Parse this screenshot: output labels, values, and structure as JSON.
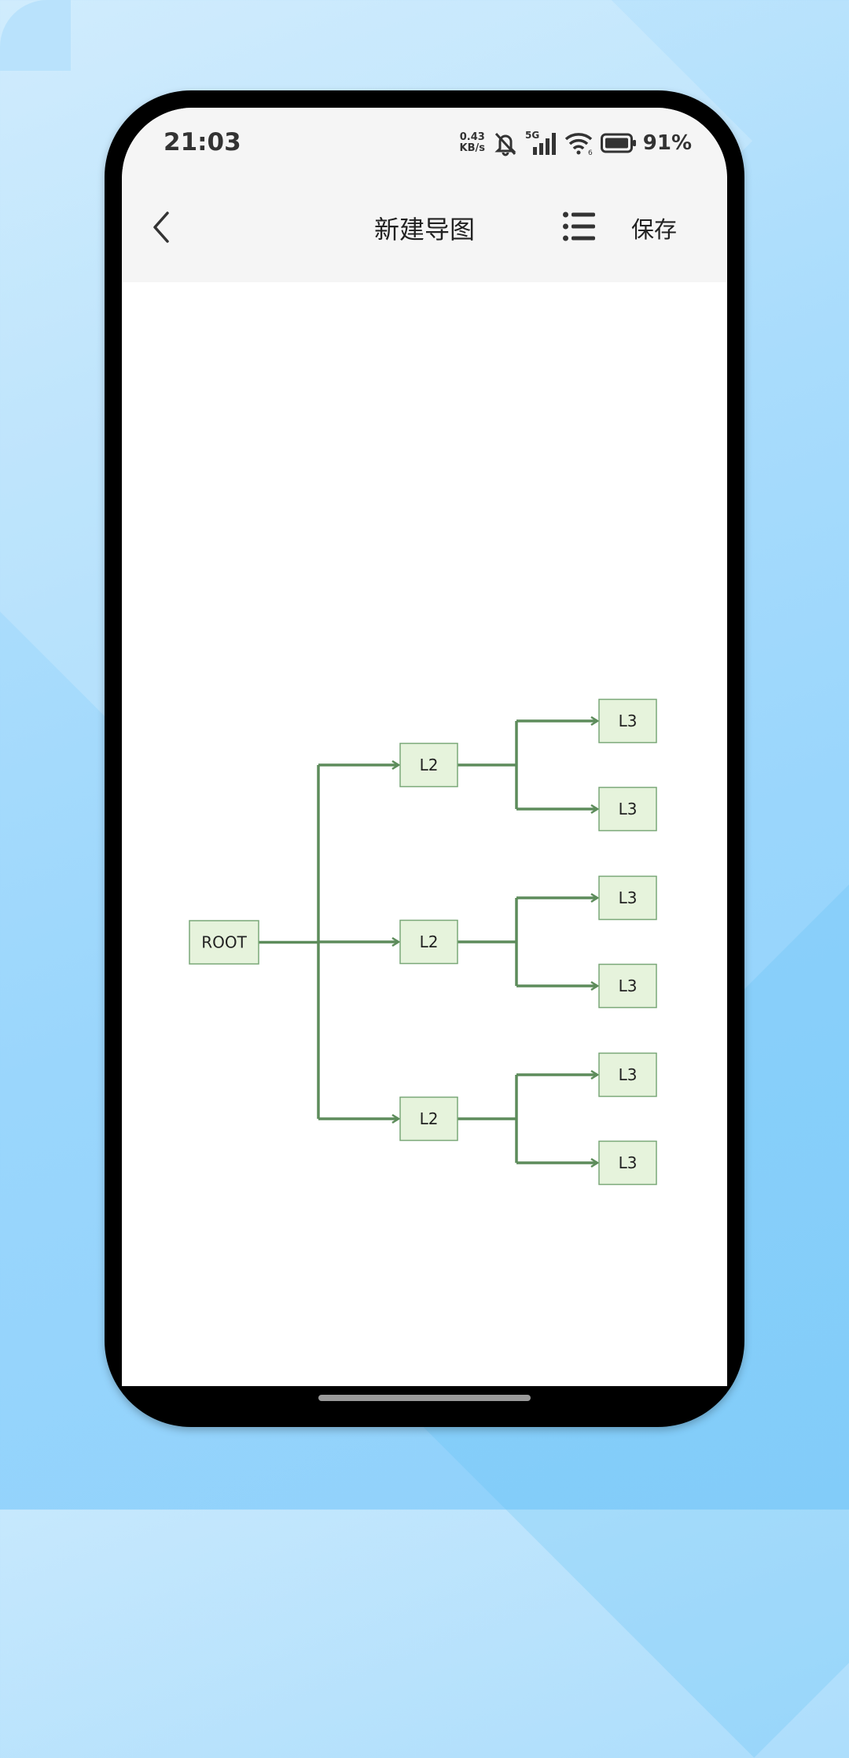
{
  "status_bar": {
    "time": "21:03",
    "net_speed_value": "0.43",
    "net_speed_unit": "KB/s",
    "signal_label": "5G",
    "battery_percent": "91%"
  },
  "header": {
    "title": "新建导图",
    "save_label": "保存",
    "back_icon": "chevron-left-icon",
    "menu_icon": "list-icon"
  },
  "mindmap": {
    "root": "ROOT",
    "children": [
      {
        "label": "L2",
        "children": [
          {
            "label": "L3"
          },
          {
            "label": "L3"
          }
        ]
      },
      {
        "label": "L2",
        "children": [
          {
            "label": "L3"
          },
          {
            "label": "L3"
          }
        ]
      },
      {
        "label": "L2",
        "children": [
          {
            "label": "L3"
          },
          {
            "label": "L3"
          }
        ]
      }
    ],
    "colors": {
      "line": "#5d8c5b",
      "node_fill": "#e6f3dc",
      "node_border": "#7aa878",
      "text": "#222222"
    }
  }
}
